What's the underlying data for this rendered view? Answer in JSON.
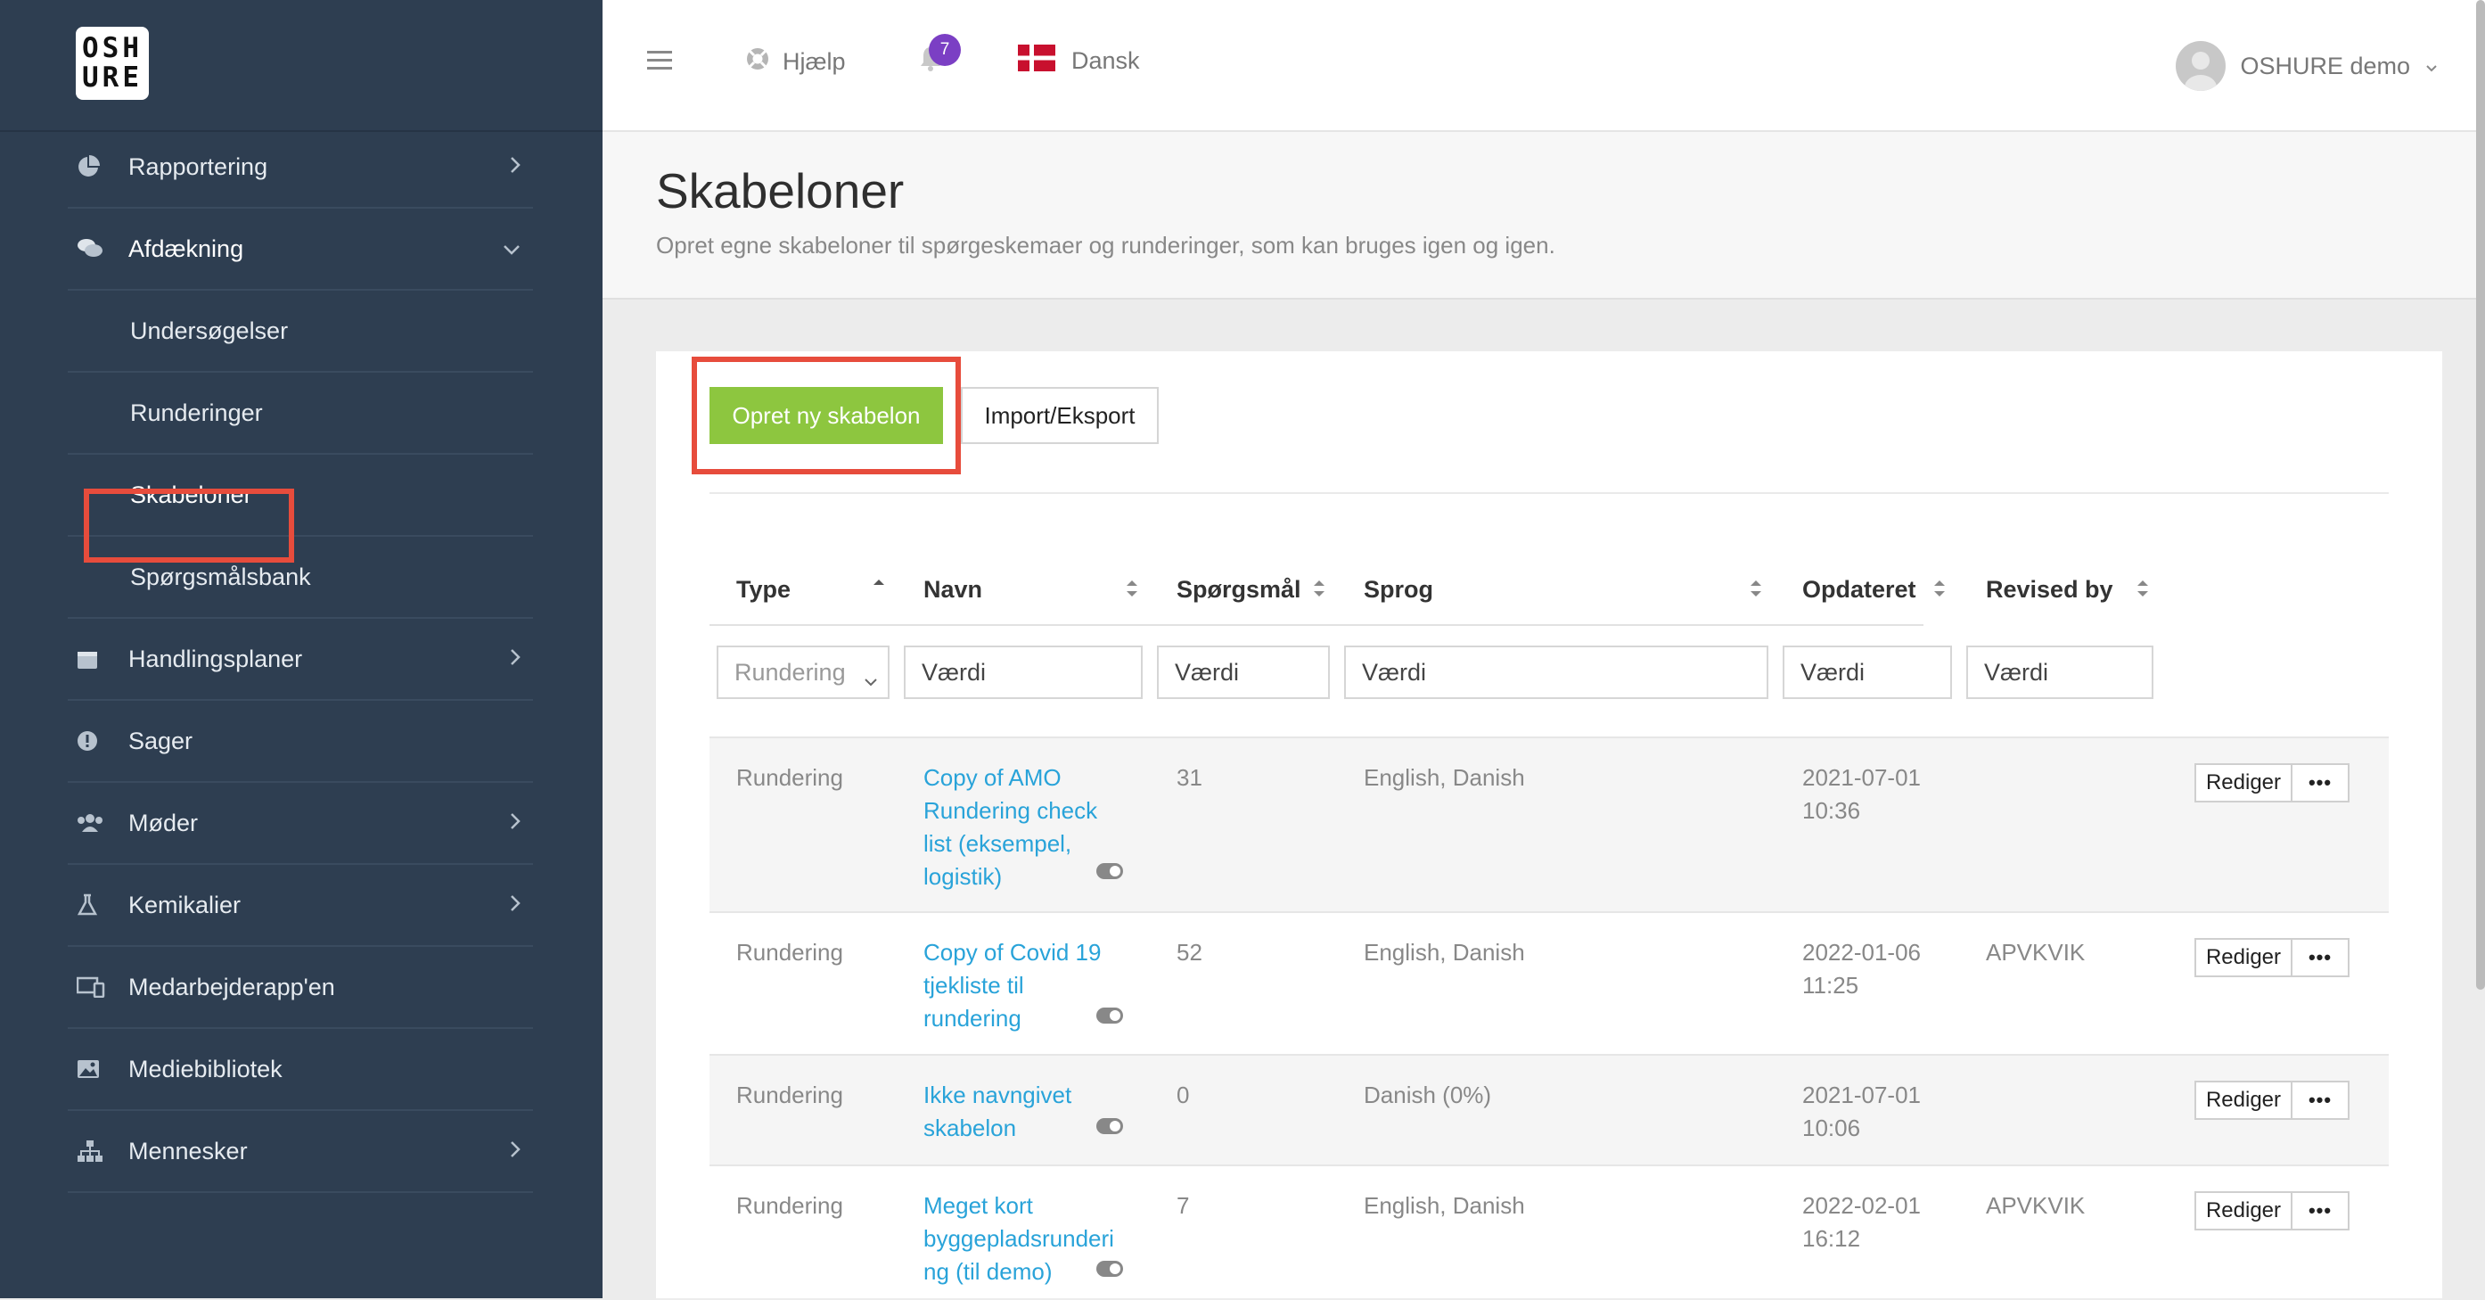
{
  "logo": {
    "line1": "OSH",
    "line2": "URE"
  },
  "sidebar": {
    "items": [
      {
        "label": "Rapportering"
      },
      {
        "label": "Afdækning"
      },
      {
        "label": "Undersøgelser"
      },
      {
        "label": "Runderinger"
      },
      {
        "label": "Skabeloner"
      },
      {
        "label": "Spørgsmålsbank"
      },
      {
        "label": "Handlingsplaner"
      },
      {
        "label": "Sager"
      },
      {
        "label": "Møder"
      },
      {
        "label": "Kemikalier"
      },
      {
        "label": "Medarbejderapp'en"
      },
      {
        "label": "Mediebibliotek"
      },
      {
        "label": "Mennesker"
      }
    ]
  },
  "topbar": {
    "help_label": "Hjælp",
    "notification_count": "7",
    "language": "Dansk",
    "user_name": "OSHURE demo"
  },
  "page": {
    "title": "Skabeloner",
    "subtitle": "Opret egne skabeloner til spørgeskemaer og runderinger, som kan bruges igen og igen."
  },
  "actions": {
    "create_label": "Opret ny skabelon",
    "import_label": "Import/Eksport"
  },
  "table": {
    "columns": [
      "Type",
      "Navn",
      "Spørgsmål",
      "Sprog",
      "Opdateret",
      "Revised by"
    ],
    "filters": {
      "type_selected": "Rundering",
      "placeholder": "Værdi"
    },
    "edit_label": "Rediger",
    "more_label": "•••",
    "rows": [
      {
        "type": "Rundering",
        "name": "Copy of AMO Rundering check list (eksempel, logistik)",
        "questions": "31",
        "languages": "English, Danish",
        "updated_date": "2021-07-01",
        "updated_time": "10:36",
        "revised_by": ""
      },
      {
        "type": "Rundering",
        "name": "Copy of Covid 19 tjekliste til rundering",
        "questions": "52",
        "languages": "English, Danish",
        "updated_date": "2022-01-06",
        "updated_time": "11:25",
        "revised_by": "APVKVIK"
      },
      {
        "type": "Rundering",
        "name": "Ikke navngivet skabelon",
        "questions": "0",
        "languages": "Danish (0%)",
        "updated_date": "2021-07-01",
        "updated_time": "10:06",
        "revised_by": ""
      },
      {
        "type": "Rundering",
        "name": "Meget kort byggepladsrunderi ng (til demo)",
        "questions": "7",
        "languages": "English, Danish",
        "updated_date": "2022-02-01",
        "updated_time": "16:12",
        "revised_by": "APVKVIK"
      }
    ]
  },
  "colors": {
    "sidebar_bg": "#2e3e51",
    "accent_green": "#8dc63f",
    "link_blue": "#29a3d9",
    "highlight_red": "#e74c3c",
    "badge_purple": "#7b3fc4"
  }
}
